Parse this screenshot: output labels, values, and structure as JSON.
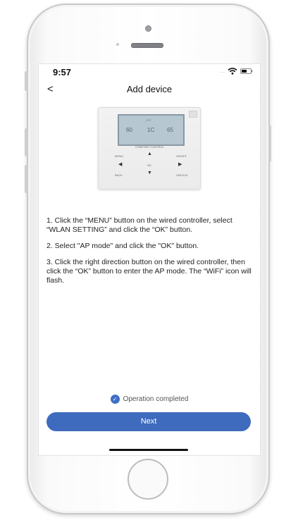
{
  "status_bar": {
    "time": "9:57",
    "signal_dots": "....",
    "wifi_icon": "wifi-icon",
    "battery_icon": "battery-icon"
  },
  "nav": {
    "back_glyph": "<",
    "title": "Add device"
  },
  "controller": {
    "lcd": {
      "left_value": "60",
      "middle_value": "1C",
      "right_value": "65",
      "left_small": "",
      "middle_small": "OFF",
      "right_small": ""
    },
    "caption": "COMFORT CONTROL",
    "buttons": {
      "menu": "MENU",
      "onoff": "ON/OFF",
      "ok": "OK",
      "back": "BACK",
      "unlock": "UNLOCK"
    }
  },
  "instructions": {
    "step1": "1. Click the “MENU” button on the wired controller, select “WLAN SETTING” and click the “OK” button.",
    "step2": "2. Select \"AP mode\" and click the \"OK\" button.",
    "step3": "3. Click the right direction button on the wired controller, then click the “OK” button to enter the AP mode. The “WiFi” icon will flash."
  },
  "confirmation": {
    "label": "Operation completed",
    "checked": true,
    "check_icon": "check-circle-icon"
  },
  "next_button": {
    "label": "Next"
  },
  "colors": {
    "accent": "#3e6bbd",
    "check": "#3f6fc4",
    "lcd_background": "#b6c7d2"
  }
}
